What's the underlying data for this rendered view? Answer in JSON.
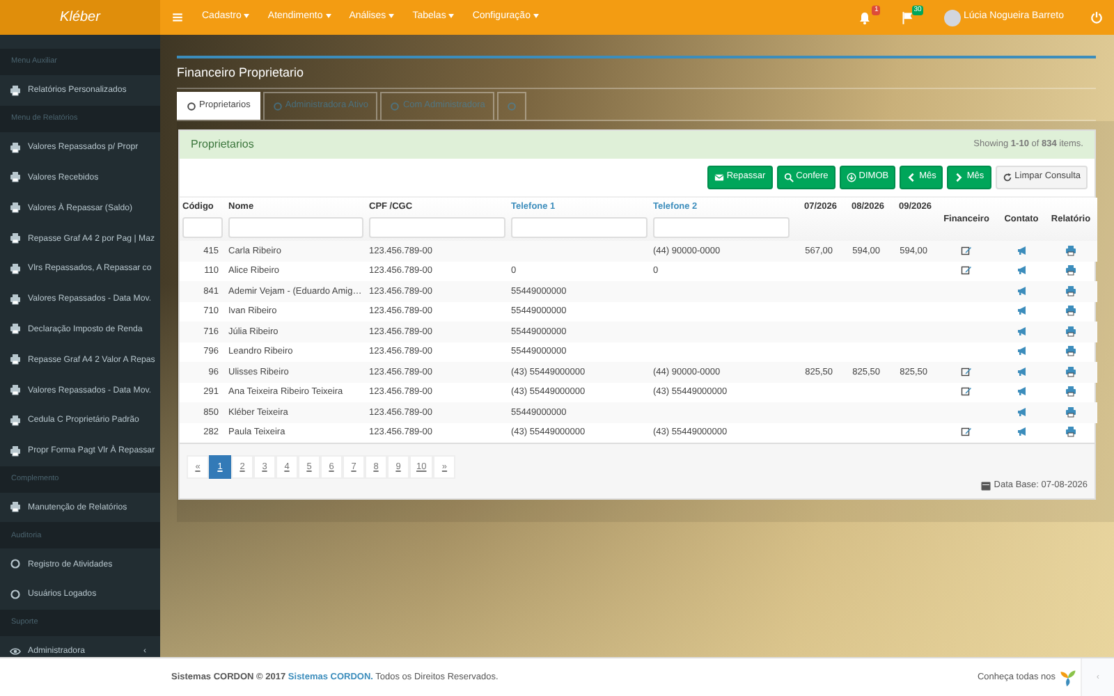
{
  "navbar": {
    "brand": "Kléber",
    "menus": [
      "Cadastro",
      "Atendimento",
      "Análises",
      "Tabelas",
      "Configuração"
    ],
    "notifications": "1",
    "messages": "30",
    "user": "Lúcia Nogueira Barreto"
  },
  "sidebar": [
    {
      "kind": "header",
      "label": "Menu Auxiliar"
    },
    {
      "kind": "printer",
      "label": "Relatórios Personalizados"
    },
    {
      "kind": "header",
      "label": "Menu de Relatórios"
    },
    {
      "kind": "printer",
      "label": "Valores Repassados p/ Propr"
    },
    {
      "kind": "printer",
      "label": "Valores Recebidos"
    },
    {
      "kind": "printer",
      "label": "Valores À Repassar (Saldo)"
    },
    {
      "kind": "printer",
      "label": "Repasse Graf A4 2 por Pag | Maz"
    },
    {
      "kind": "printer",
      "label": "Vlrs Repassados, A Repassar co"
    },
    {
      "kind": "printer",
      "label": "Valores Repassados - Data Mov."
    },
    {
      "kind": "printer",
      "label": "Declaração Imposto de Renda"
    },
    {
      "kind": "printer",
      "label": "Repasse Graf A4 2 Valor A Repas"
    },
    {
      "kind": "printer",
      "label": "Valores Repassados - Data Mov."
    },
    {
      "kind": "printer",
      "label": "Cedula C Proprietário Padrão"
    },
    {
      "kind": "printer",
      "label": "Propr Forma Pagt Vlr À Repassar"
    },
    {
      "kind": "header",
      "label": "Complemento"
    },
    {
      "kind": "printer",
      "label": "Manutenção de Relatórios"
    },
    {
      "kind": "header",
      "label": "Auditoria"
    },
    {
      "kind": "circle",
      "label": "Registro de Atividades"
    },
    {
      "kind": "circle",
      "label": "Usuários Logados"
    },
    {
      "kind": "header",
      "label": "Suporte"
    },
    {
      "kind": "eye",
      "label": "Administradora",
      "caret": "‹"
    }
  ],
  "page": {
    "title": "Financeiro Proprietario",
    "tabs": [
      {
        "label": "Proprietarios",
        "selected": true
      },
      {
        "label": "Administradora Ativo",
        "selected": false
      },
      {
        "label": "Com Administradora",
        "selected": false
      },
      {
        "selected": false
      }
    ],
    "panel": {
      "title": "Proprietarios",
      "summary": "Showing **1-10** of **834** items.",
      "buttons": [
        {
          "kind": "mail",
          "label": "Repassar"
        },
        {
          "kind": "search",
          "label": "Confere"
        },
        {
          "kind": "download",
          "label": "DIMOB"
        },
        {
          "kind": "prev",
          "label": "Mês"
        },
        {
          "kind": "next",
          "label": "Mês"
        },
        {
          "kind": "refresh",
          "label": "Limpar Consulta"
        }
      ],
      "columns": [
        {
          "label": "Código",
          "link": false,
          "filter": true
        },
        {
          "label": "Nome",
          "link": false,
          "filter": true
        },
        {
          "label": "CPF /CGC",
          "link": false,
          "filter": true
        },
        {
          "label": "Telefone 1",
          "link": true,
          "filter": true
        },
        {
          "label": "Telefone 2",
          "link": true,
          "filter": true
        },
        {
          "label": "07/2026",
          "link": false,
          "filter": false
        },
        {
          "label": "08/2026",
          "link": false,
          "filter": false
        },
        {
          "label": "09/2026",
          "link": false,
          "filter": false
        },
        {
          "label": "Financeiro",
          "link": false,
          "filter": false
        },
        {
          "label": "Contato",
          "link": false,
          "filter": false
        },
        {
          "label": "Relatório",
          "link": false,
          "filter": false
        }
      ],
      "rows": [
        {
          "codigo": "415",
          "nome": "Carla Ribeiro",
          "cpf": "123.456.789-00",
          "tel1": "",
          "tel2": "(44) 90000-0000",
          "m1": "567,00",
          "m2": "594,00",
          "m3": "594,00",
          "financeiro": true
        },
        {
          "codigo": "110",
          "nome": "Alice Ribeiro",
          "cpf": "123.456.789-00",
          "tel1": "0",
          "tel2": "0",
          "m1": "",
          "m2": "",
          "m3": "",
          "financeiro": true
        },
        {
          "codigo": "841",
          "nome": "Ademir Vejam - (Eduardo Amig…",
          "cpf": "123.456.789-00",
          "tel1": "55449000000",
          "tel2": "",
          "m1": "",
          "m2": "",
          "m3": "",
          "financeiro": false
        },
        {
          "codigo": "710",
          "nome": "Ivan Ribeiro",
          "cpf": "123.456.789-00",
          "tel1": "55449000000",
          "tel2": "",
          "m1": "",
          "m2": "",
          "m3": "",
          "financeiro": false
        },
        {
          "codigo": "716",
          "nome": "Júlia Ribeiro",
          "cpf": "123.456.789-00",
          "tel1": "55449000000",
          "tel2": "",
          "m1": "",
          "m2": "",
          "m3": "",
          "financeiro": false
        },
        {
          "codigo": "796",
          "nome": "Leandro Ribeiro",
          "cpf": "123.456.789-00",
          "tel1": "55449000000",
          "tel2": "",
          "m1": "",
          "m2": "",
          "m3": "",
          "financeiro": false
        },
        {
          "codigo": "96",
          "nome": "Ulisses Ribeiro",
          "cpf": "123.456.789-00",
          "tel1": "(43) 55449000000",
          "tel2": "(44) 90000-0000",
          "m1": "825,50",
          "m2": "825,50",
          "m3": "825,50",
          "financeiro": true
        },
        {
          "codigo": "291",
          "nome": "Ana Teixeira Ribeiro Teixeira",
          "cpf": "123.456.789-00",
          "tel1": "(43) 55449000000",
          "tel2": "(43) 55449000000",
          "m1": "",
          "m2": "",
          "m3": "",
          "financeiro": true
        },
        {
          "codigo": "850",
          "nome": "Kléber Teixeira",
          "cpf": "123.456.789-00",
          "tel1": "55449000000",
          "tel2": "",
          "m1": "",
          "m2": "",
          "m3": "",
          "financeiro": false
        },
        {
          "codigo": "282",
          "nome": "Paula Teixeira",
          "cpf": "123.456.789-00",
          "tel1": "(43) 55449000000",
          "tel2": "(43) 55449000000",
          "m1": "",
          "m2": "",
          "m3": "",
          "financeiro": true
        }
      ],
      "pagination": {
        "prev": "«",
        "next": "»",
        "pages": [
          {
            "label": "1",
            "selected": true
          },
          {
            "label": "2",
            "selected": false
          },
          {
            "label": "3",
            "selected": false
          },
          {
            "label": "4",
            "selected": false
          },
          {
            "label": "5",
            "selected": false
          },
          {
            "label": "6",
            "selected": false
          },
          {
            "label": "7",
            "selected": false
          },
          {
            "label": "8",
            "selected": false
          },
          {
            "label": "9",
            "selected": false
          },
          {
            "label": "10",
            "selected": false
          }
        ]
      },
      "database": "Data Base: 07-08-2026"
    }
  },
  "footer": {
    "text": "**Sistemas CORDON © 2017**",
    "link": "Sistemas CORDON.",
    "suffix": "Todos os Direitos Reservados.",
    "right": "Conheça todas nos",
    "collapse": "‹"
  }
}
